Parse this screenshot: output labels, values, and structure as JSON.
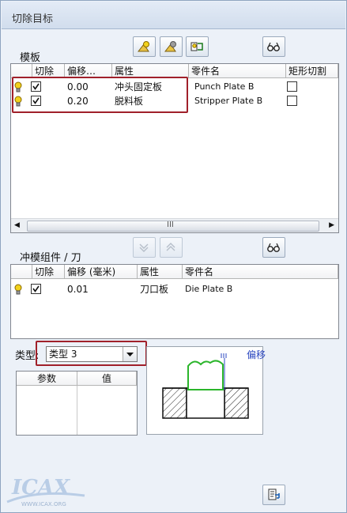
{
  "window": {
    "title": "切除目标"
  },
  "plates": {
    "label": "模板",
    "columns": [
      "切除",
      "偏移…",
      "属性",
      "零件名",
      "矩形切割"
    ],
    "rows": [
      {
        "cut": true,
        "offset": "0.00",
        "attr": "冲头固定板",
        "part": "Punch Plate B",
        "rect": false
      },
      {
        "cut": true,
        "offset": "0.20",
        "attr": "脱料板",
        "part": "Stripper Plate B",
        "rect": false
      }
    ],
    "scroll_mark": "III"
  },
  "punch": {
    "label": "冲模组件 / 刀",
    "columns": [
      "切除",
      "偏移 (毫米)",
      "属性",
      "零件名"
    ],
    "rows": [
      {
        "cut": true,
        "offset": "0.01",
        "attr": "刀口板",
        "part": "Die Plate B"
      }
    ]
  },
  "type_selector": {
    "label": "类型:",
    "value": "类型 3"
  },
  "params_table": {
    "columns": [
      "参数",
      "值"
    ]
  },
  "preview": {
    "offset_label": "偏移"
  },
  "watermark": {
    "logo": "ICAX",
    "url": "WWW.ICAX.ORG"
  },
  "icons": {
    "toolbar_top": [
      "bulb-on-icon",
      "bulb-off-icon",
      "bulb-toggle-icon",
      "glasses-icon"
    ],
    "toolbar_mid": [
      "chevron-down-icon",
      "chevron-up-icon",
      "glasses-icon"
    ],
    "bottom": "export-icon"
  },
  "colors": {
    "callout": "#a0202a",
    "bulb": "#f2d21c",
    "profile": "#2bb52b"
  }
}
